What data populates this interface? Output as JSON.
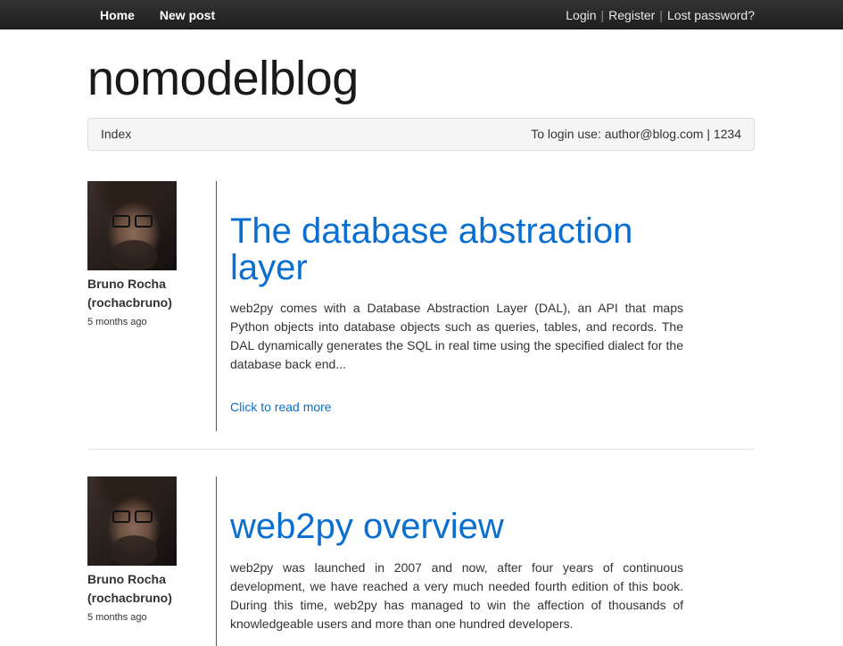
{
  "nav": {
    "home": "Home",
    "new_post": "New post",
    "login": "Login",
    "register": "Register",
    "lost_password": "Lost password?",
    "separator": "|"
  },
  "brand": "nomodelblog",
  "breadcrumb": {
    "index": "Index",
    "login_hint": "To login use: author@blog.com | 1234"
  },
  "posts": [
    {
      "author_name": "Bruno Rocha",
      "author_handle": "(rochacbruno)",
      "time_ago": "5 months ago",
      "title": "The database abstraction layer",
      "excerpt": "web2py comes with a Database Abstraction Layer (DAL), an API that maps Python objects into database objects such as queries, tables, and records. The DAL dynamically generates the SQL in real time using the specified dialect for the database back end...",
      "read_more": "Click to read more"
    },
    {
      "author_name": "Bruno Rocha",
      "author_handle": "(rochacbruno)",
      "time_ago": "5 months ago",
      "title": "web2py overview",
      "excerpt": "web2py was launched in 2007 and now, after four years of continuous development, we have reached a very much needed fourth edition of this book. During this time, web2py has managed to win the affection of thousands of knowledgeable users and more than one hundred developers."
    }
  ],
  "colors": {
    "navbar": "#222222",
    "link": "#0b6fcf",
    "breadcrumb_bg": "#f5f5f5"
  }
}
